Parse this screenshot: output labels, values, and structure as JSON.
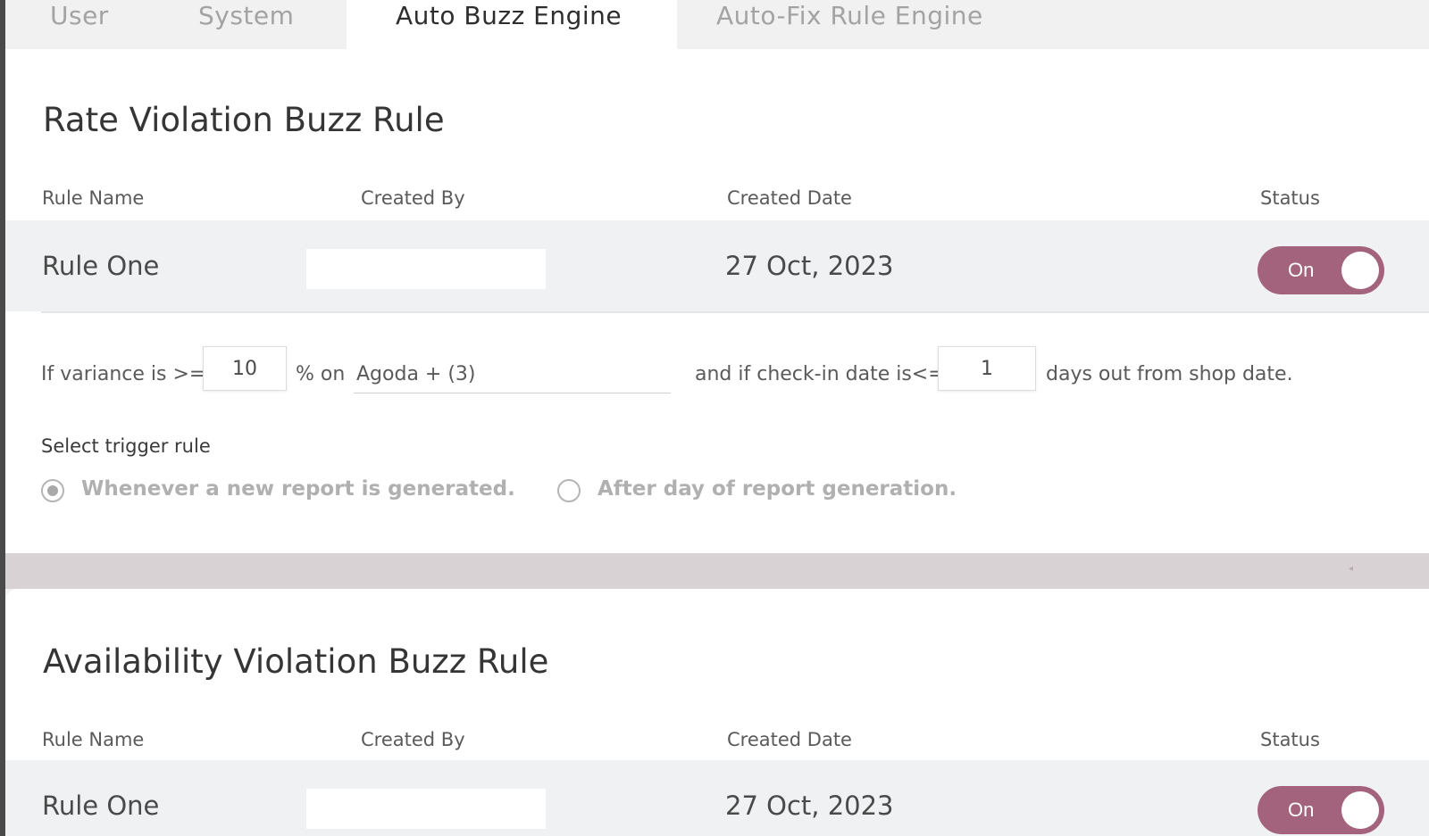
{
  "tabs": {
    "user": "User",
    "system": "System",
    "auto_buzz": "Auto Buzz Engine",
    "auto_fix": "Auto-Fix Rule Engine",
    "active": "Auto Buzz Engine"
  },
  "rate_rule": {
    "title": "Rate Violation Buzz Rule",
    "columns": {
      "rule_name": "Rule Name",
      "created_by": "Created By",
      "created_date": "Created Date",
      "status": "Status"
    },
    "row": {
      "name": "Rule One",
      "created_by": "",
      "created_date": "27 Oct, 2023",
      "status_label": "On",
      "status_on": true
    },
    "condition": {
      "prefix": "If variance is >=",
      "variance_value": "10",
      "percent_on": "% on",
      "channel_select": "Agoda + (3)",
      "and_if": "and if check-in date is<=",
      "days_value": "1",
      "suffix": "days out from shop date."
    },
    "trigger": {
      "label": "Select trigger rule",
      "options": [
        {
          "label": "Whenever a new report is generated.",
          "selected": true
        },
        {
          "label": "After day of report generation.",
          "selected": false
        }
      ]
    }
  },
  "availability_rule": {
    "title": "Availability Violation Buzz Rule",
    "columns": {
      "rule_name": "Rule Name",
      "created_by": "Created By",
      "created_date": "Created Date",
      "status": "Status"
    },
    "row": {
      "name": "Rule One",
      "created_by": "",
      "created_date": "27 Oct, 2023",
      "status_label": "On",
      "status_on": true
    }
  },
  "colors": {
    "toggle_on": "#a3637c",
    "row_bg": "#f0f1f3",
    "divider_band": "#d8d2d5"
  },
  "icons": {
    "radio_selected": "radio-selected-icon",
    "radio_unselected": "radio-unselected-icon"
  }
}
